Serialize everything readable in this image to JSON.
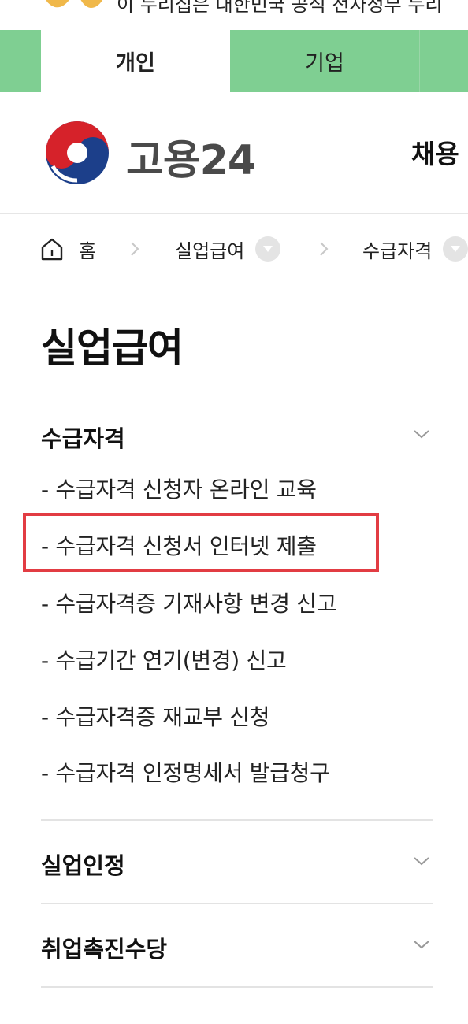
{
  "gov_banner": {
    "text": "이 누리집은 대한민국 공식 전자정부 누리"
  },
  "tabs": [
    {
      "label": "개인"
    },
    {
      "label": "기업"
    }
  ],
  "header": {
    "logo_text": "고용24",
    "menu_partial": "채용"
  },
  "breadcrumb": {
    "home": "홈",
    "level1": "실업급여",
    "level2": "수급자격"
  },
  "page": {
    "title": "실업급여"
  },
  "sections": [
    {
      "label": "수급자격",
      "items": [
        "- 수급자격 신청자 온라인 교육",
        "- 수급자격 신청서 인터넷 제출",
        "- 수급자격증 기재사항 변경 신고",
        "- 수급기간 연기(변경) 신고",
        "- 수급자격증 재교부 신청",
        "- 수급자격 인정명세서 발급청구"
      ]
    },
    {
      "label": "실업인정"
    },
    {
      "label": "취업촉진수당"
    }
  ],
  "colors": {
    "tab_bar": "#7fcf92",
    "highlight": "#e23c43",
    "logo_red": "#d6222a",
    "logo_blue": "#1c3f8a"
  },
  "highlighted_item": "- 수급자격 신청서 인터넷 제출"
}
